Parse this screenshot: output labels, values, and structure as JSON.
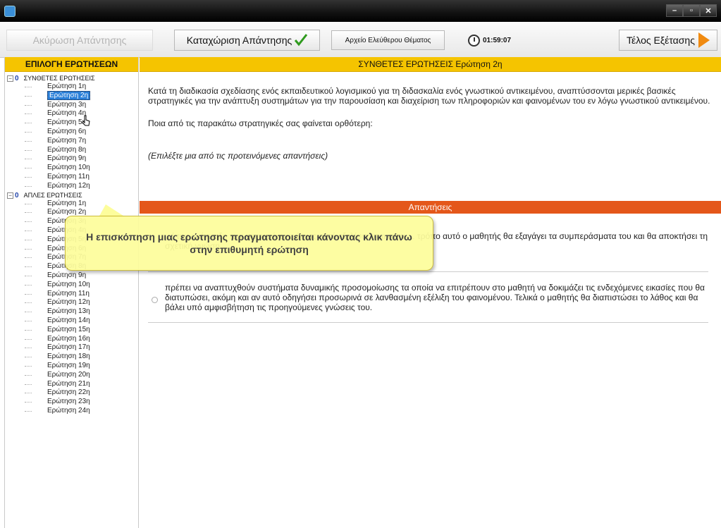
{
  "toolbar": {
    "cancel_label": "Ακύρωση Απάντησης",
    "submit_label": "Καταχώριση Απάντησης",
    "file_label": "Αρχείο Ελεύθερου Θέματος",
    "timer": "01:59:07",
    "end_label": "Τέλος Εξέτασης"
  },
  "sidebar": {
    "title": "ΕΠΙΛΟΓΗ ΕΡΩΤΗΣΕΩΝ",
    "groups": [
      {
        "count": "0",
        "name": "ΣΥΝΘΕΤΕΣ ΕΡΩΤΗΣΕΙΣ",
        "items": [
          "Ερώτηση 1η",
          "Ερώτηση 2η",
          "Ερώτηση 3η",
          "Ερώτηση 4η",
          "Ερώτηση 5η",
          "Ερώτηση 6η",
          "Ερώτηση 7η",
          "Ερώτηση 8η",
          "Ερώτηση 9η",
          "Ερώτηση 10η",
          "Ερώτηση 11η",
          "Ερώτηση 12η"
        ]
      },
      {
        "count": "0",
        "name": "ΑΠΛΕΣ ΕΡΩΤΗΣΕΙΣ",
        "items": [
          "Ερώτηση 1η",
          "Ερώτηση 2η",
          "Ερώτηση 3η",
          "Ερώτηση 4η",
          "Ερώτηση 5η",
          "Ερώτηση 6η",
          "Ερώτηση 7η",
          "Ερώτηση 8η",
          "Ερώτηση 9η",
          "Ερώτηση 10η",
          "Ερώτηση 11η",
          "Ερώτηση 12η",
          "Ερώτηση 13η",
          "Ερώτηση 14η",
          "Ερώτηση 15η",
          "Ερώτηση 16η",
          "Ερώτηση 17η",
          "Ερώτηση 18η",
          "Ερώτηση 19η",
          "Ερώτηση 20η",
          "Ερώτηση 21η",
          "Ερώτηση 22η",
          "Ερώτηση 23η",
          "Ερώτηση 24η"
        ]
      }
    ]
  },
  "question": {
    "header": "ΣΥΝΘΕΤΕΣ ΕΡΩΤΗΣΕΙΣ Ερώτηση 2η",
    "text": "Κατά τη διαδικασία σχεδίασης ενός εκπαιδευτικού λογισμικού για τη διδασκαλία ενός γνωστικού αντικειμένου, αναπτύσσονται μερικές βασικές στρατηγικές για την ανάπτυξη συστημάτων για την παρουσίαση και διαχείριση των πληροφοριών και φαινομένων του εν λόγω γνωστικού αντικειμένου.",
    "prompt": "Ποια από τις παρακάτω στρατηγικές σας φαίνεται ορθότερη:",
    "hint": "(Επιλέξτε μια από τις προτεινόμενες απαντήσεις)"
  },
  "answers": {
    "header": "Απαντήσεις",
    "options": [
      "...ί την ανάπτυξη των φαινομένων, όπως αυτά εξελίσσονται στην ... τρόπο αυτό ο μαθητής θα εξαγάγει τα συμπεράσματα του και θα αποκτήσει τη σχετική γνώση",
      "πρέπει να αναπτυχθούν συστήματα δυναμικής προσομοίωσης τα οποία να επιτρέπουν στο μαθητή να δοκιμάζει τις ενδεχόμενες εικασίες που θα διατυπώσει, ακόμη και αν αυτό οδηγήσει προσωρινά σε λανθασμένη εξέλιξη του φαινομένου. Τελικά ο μαθητής θα διαπιστώσει το λάθος και θα βάλει υπό αμφισβήτηση τις προηγούμενες γνώσεις του."
    ]
  },
  "tooltip": {
    "text": "Η επισκόπηση μιας ερώτησης πραγματοποιείται κάνοντας κλικ πάνω στην επιθυμητή ερώτηση"
  },
  "colors": {
    "header_yellow": "#f5c400",
    "answers_orange": "#e4571a",
    "selection_blue": "#2a7fd8",
    "tooltip_yellow": "#fdfd9c"
  }
}
